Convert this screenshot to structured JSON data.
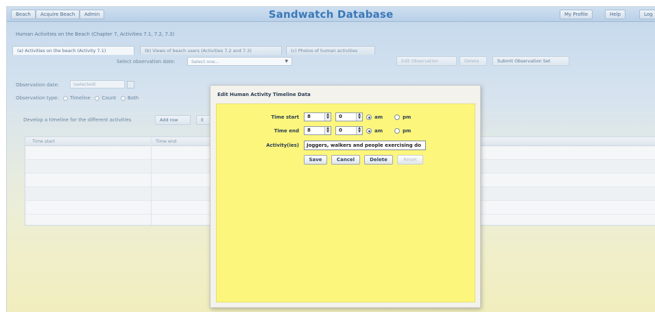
{
  "topbar": {
    "nav": [
      "Beach",
      "Acquire Beach",
      "Admin"
    ],
    "app_title": "Sandwatch Database",
    "right_buttons": [
      "My Profile",
      "Help",
      "Log"
    ]
  },
  "breadcrumb": "Human Activities on the Beach (Chapter 7, Activities 7.1, 7.2, 7.3)",
  "tabs": [
    "(a) Activities on the beach (Activity 7.1)",
    "(b) Views of beach users (Activities 7.2 and 7.3)",
    "(c) Photos of human activities"
  ],
  "observation_select": {
    "label": "Select observation date:",
    "value": "Select one..."
  },
  "toolbar_buttons": [
    "Edit Observation",
    "Delete",
    "Submit Observation Set"
  ],
  "observation_date": {
    "label": "Observation date:",
    "value": "(selected)"
  },
  "observation_type": {
    "label": "Observation type:",
    "options": [
      "Timeline",
      "Count",
      "Both"
    ]
  },
  "timeline_section": {
    "label": "Develop a timeline for the different activities",
    "add_button": "Add row",
    "second_button": "E"
  },
  "grid": {
    "columns": [
      "Time start",
      "Time end"
    ],
    "rows": 5
  },
  "dialog": {
    "title": "Edit Human Activity Timeline Data",
    "time_start": {
      "label": "Time start",
      "hour": "8",
      "minute": "0",
      "am": "am",
      "pm": "pm",
      "selected": "am"
    },
    "time_end": {
      "label": "Time end",
      "hour": "8",
      "minute": "0",
      "am": "am",
      "pm": "pm",
      "selected": "am"
    },
    "activity": {
      "label": "Activity(ies)",
      "value": "Joggers, walkers and people exercising do"
    },
    "buttons": {
      "save": "Save",
      "cancel": "Cancel",
      "delete": "Delete",
      "reset": "Reset"
    }
  }
}
